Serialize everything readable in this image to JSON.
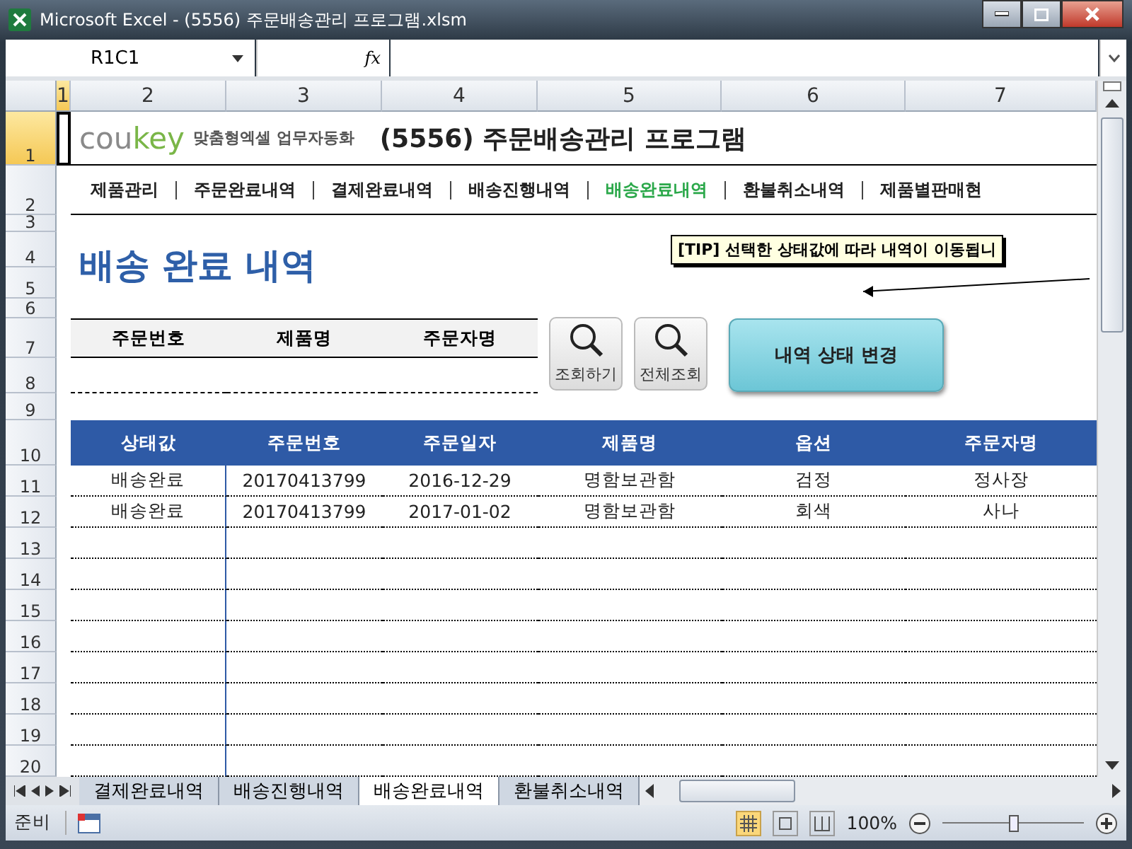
{
  "window": {
    "title": "Microsoft Excel - (5556) 주문배송관리 프로그램.xlsm"
  },
  "formula_bar": {
    "name_box": "R1C1",
    "fx": "fx"
  },
  "column_headers": [
    {
      "label": "1",
      "selected": true
    },
    {
      "label": "2",
      "selected": false
    },
    {
      "label": "3",
      "selected": false
    },
    {
      "label": "4",
      "selected": false
    },
    {
      "label": "5",
      "selected": false
    },
    {
      "label": "6",
      "selected": false
    },
    {
      "label": "7",
      "selected": false
    }
  ],
  "row_headers": [
    {
      "label": "1",
      "selected": true
    },
    {
      "label": "2",
      "selected": false
    },
    {
      "label": "3",
      "selected": false
    },
    {
      "label": "4",
      "selected": false
    },
    {
      "label": "5",
      "selected": false
    },
    {
      "label": "6",
      "selected": false
    },
    {
      "label": "7",
      "selected": false
    },
    {
      "label": "8",
      "selected": false
    },
    {
      "label": "9",
      "selected": false
    },
    {
      "label": "10",
      "selected": false
    },
    {
      "label": "11",
      "selected": false
    },
    {
      "label": "12",
      "selected": false
    },
    {
      "label": "13",
      "selected": false
    },
    {
      "label": "14",
      "selected": false
    },
    {
      "label": "15",
      "selected": false
    },
    {
      "label": "16",
      "selected": false
    },
    {
      "label": "17",
      "selected": false
    },
    {
      "label": "18",
      "selected": false
    },
    {
      "label": "19",
      "selected": false
    },
    {
      "label": "20",
      "selected": false
    }
  ],
  "logo": {
    "parts": [
      "cou",
      "key"
    ],
    "tagline": "맞춤형엑셀 업무자동화"
  },
  "program_title": "(5556) 주문배송관리 프로그램",
  "nav": [
    {
      "label": "제품관리",
      "selected": false
    },
    {
      "label": "주문완료내역",
      "selected": false
    },
    {
      "label": "결제완료내역",
      "selected": false
    },
    {
      "label": "배송진행내역",
      "selected": false
    },
    {
      "label": "배송완료내역",
      "selected": true
    },
    {
      "label": "환불취소내역",
      "selected": false
    },
    {
      "label": "제품별판매현",
      "selected": false
    }
  ],
  "page_heading": "배송 완료 내역",
  "tip": "[TIP] 선택한 상태값에 따라 내역이 이동됩니",
  "search": {
    "columns": [
      "주문번호",
      "제품명",
      "주문자명"
    ]
  },
  "buttons": [
    {
      "label": "조회하기",
      "kind": "search"
    },
    {
      "label": "전체조회",
      "kind": "search"
    },
    {
      "label": "내역 상태 변경",
      "kind": "action"
    }
  ],
  "table": {
    "columns": [
      "상태값",
      "주문번호",
      "주문일자",
      "제품명",
      "옵션",
      "주문자명"
    ],
    "rows": [
      [
        "배송완료",
        "20170413799",
        "2016-12-29",
        "명함보관함",
        "검정",
        "정사장"
      ],
      [
        "배송완료",
        "20170413799",
        "2017-01-02",
        "명함보관함",
        "회색",
        "사나"
      ]
    ]
  },
  "sheet_tabs": [
    {
      "label": "결제완료내역",
      "selected": false
    },
    {
      "label": "배송진행내역",
      "selected": false
    },
    {
      "label": "배송완료내역",
      "selected": true
    },
    {
      "label": "환불취소내역",
      "selected": false
    }
  ],
  "status_bar": {
    "text": "준비",
    "zoom": "100%",
    "level": 0.5
  }
}
